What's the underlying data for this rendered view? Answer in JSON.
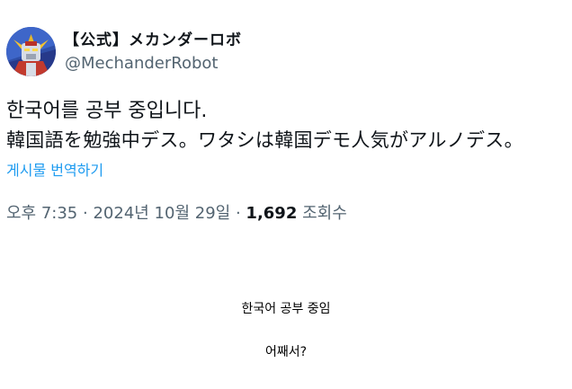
{
  "tweet": {
    "display_name": "【公式】メカンダーロボ",
    "handle": "@MechanderRobot",
    "text_line1": "한국어를 공부 중입니다.",
    "text_line2": "韓国語を勉強中デス。ワタシは韓国デモ人気がアルノデス。",
    "translate_link": "게시물 번역하기",
    "time": "오후 7:35",
    "date": "2024년 10월 29일",
    "separator": "·",
    "views_count": "1,692",
    "views_label": "조회수"
  },
  "captions": {
    "line1": "한국어 공부 중임",
    "line2": "어째서?"
  },
  "colors": {
    "link": "#1d9bf0",
    "muted": "#536471",
    "text": "#0f1419"
  },
  "icons": {
    "avatar": "robot-avatar"
  }
}
